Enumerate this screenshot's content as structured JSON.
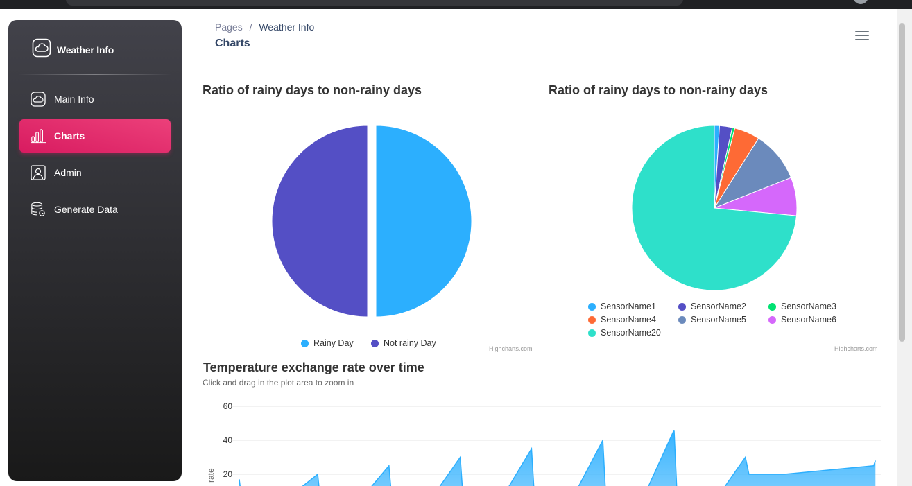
{
  "sidebar": {
    "brand": "Weather Info",
    "items": [
      {
        "label": "Main Info",
        "icon": "cloud-icon",
        "active": false
      },
      {
        "label": "Charts",
        "icon": "bar-chart-icon",
        "active": true
      },
      {
        "label": "Admin",
        "icon": "user-icon",
        "active": false
      },
      {
        "label": "Generate Data",
        "icon": "database-icon",
        "active": false
      }
    ]
  },
  "header": {
    "breadcrumb_root": "Pages",
    "breadcrumb_sep": "/",
    "breadcrumb_current": "Weather Info",
    "page_title": "Charts"
  },
  "charts": {
    "pie1": {
      "title": "Ratio of rainy days to non-rainy days",
      "credit": "Highcharts.com"
    },
    "pie2": {
      "title": "Ratio of rainy days to non-rainy days",
      "credit": "Highcharts.com"
    },
    "area": {
      "title": "Temperature exchange rate over time",
      "subtitle": "Click and drag in the plot area to zoom in",
      "ylabel": "rate"
    }
  },
  "chart_data": [
    {
      "type": "pie",
      "title": "Ratio of rainy days to non-rainy days",
      "slices": [
        {
          "name": "Rainy Day",
          "value": 50,
          "color": "#2caffe"
        },
        {
          "name": "Not rainy Day",
          "value": 50,
          "color": "#544fc5"
        }
      ],
      "legend": "bottom-center"
    },
    {
      "type": "pie",
      "title": "Ratio of rainy days to non-rainy days",
      "slices": [
        {
          "name": "SensorName1",
          "value": 1,
          "color": "#2caffe"
        },
        {
          "name": "SensorName2",
          "value": 2.5,
          "color": "#544fc5"
        },
        {
          "name": "SensorName3",
          "value": 0.5,
          "color": "#00e272"
        },
        {
          "name": "SensorName4",
          "value": 5,
          "color": "#fe6a35"
        },
        {
          "name": "SensorName5",
          "value": 10,
          "color": "#6b8abc"
        },
        {
          "name": "SensorName6",
          "value": 7.5,
          "color": "#d568fb"
        },
        {
          "name": "SensorName20",
          "value": 73.5,
          "color": "#2ee0ca"
        }
      ],
      "legend": "bottom"
    },
    {
      "type": "area",
      "title": "Temperature exchange rate over time",
      "subtitle": "Click and drag in the plot area to zoom in",
      "ylabel": "rate",
      "ylim": [
        0,
        60
      ],
      "yticks": [
        20,
        40,
        60
      ],
      "color": "#2caffe",
      "x": [
        0,
        0.1,
        1,
        2.2,
        2.3,
        3.2,
        4.2,
        4.3,
        5.2,
        6.2,
        6.3,
        7.2,
        8.2,
        8.3,
        9.2,
        10.2,
        10.3,
        11.2,
        12.2,
        12.3,
        13.2,
        14.2,
        14.3,
        15.2,
        15.25,
        15.3,
        17.8,
        17.85
      ],
      "y": [
        17,
        0,
        0,
        20,
        0,
        0,
        25,
        0,
        0,
        30,
        0,
        0,
        35,
        0,
        0,
        40,
        0,
        0,
        46,
        0,
        0,
        30,
        20,
        20,
        20,
        20,
        25,
        28
      ]
    }
  ]
}
